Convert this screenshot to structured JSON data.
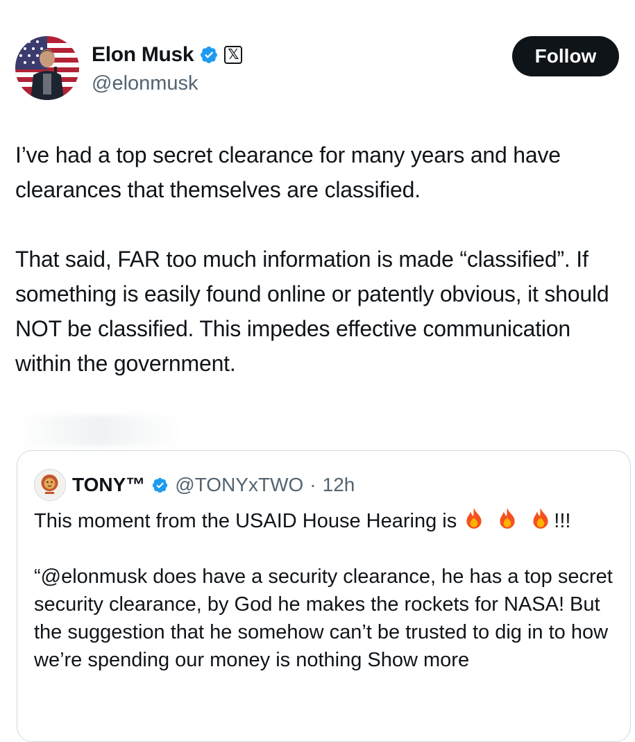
{
  "author": {
    "display_name": "Elon Musk",
    "handle": "@elonmusk",
    "verified_icon": "verified-badge-icon",
    "affiliate_icon": "x-logo-icon"
  },
  "follow_button": {
    "label": "Follow"
  },
  "tweet": {
    "paragraphs": [
      "I’ve had a top secret clearance for many years and have clearances that themselves are classified.",
      "That said, FAR too much information is made “classified”. If something is easily found online or patently obvious, it should NOT be classified. This impedes effective communication within the government."
    ]
  },
  "quoted_tweet": {
    "display_name": "TONY™",
    "handle": "@TONYxTWO",
    "separator": "·",
    "time": "12h",
    "line1_prefix": "This moment from the USAID House Hearing is",
    "line1_suffix": "!!!",
    "emoji": [
      "fire-emoji-icon",
      "fire-emoji-icon",
      "fire-emoji-icon"
    ],
    "paragraph2": "“@elonmusk does have a security clearance, he has a top secret security clearance, by God he makes the rockets for NASA! But the suggestion that he somehow can’t be trusted to dig in to how we’re spending our money is nothing",
    "show_more": "Show more"
  },
  "colors": {
    "text_primary": "#0f1419",
    "text_secondary": "#536471",
    "verified_blue": "#1d9bf0",
    "border": "#cfd9de",
    "button_bg": "#0f1419"
  }
}
